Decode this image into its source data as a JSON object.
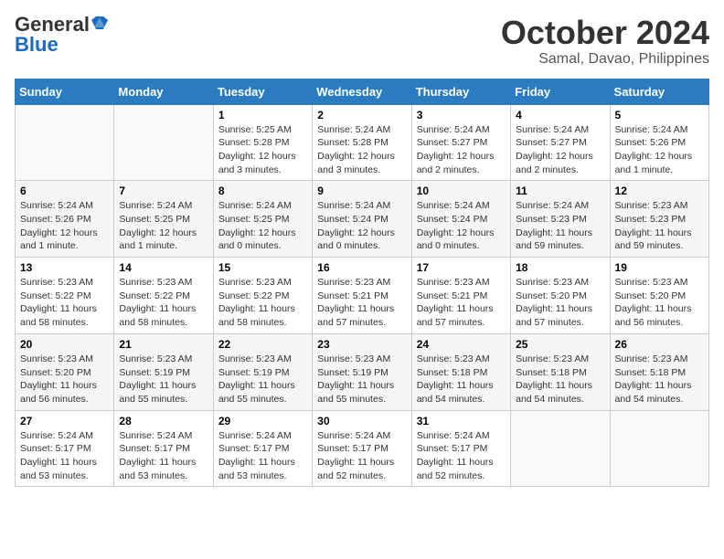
{
  "header": {
    "logo_general": "General",
    "logo_blue": "Blue",
    "month_title": "October 2024",
    "subtitle": "Samal, Davao, Philippines"
  },
  "days_of_week": [
    "Sunday",
    "Monday",
    "Tuesday",
    "Wednesday",
    "Thursday",
    "Friday",
    "Saturday"
  ],
  "weeks": [
    [
      {
        "day": "",
        "detail": ""
      },
      {
        "day": "",
        "detail": ""
      },
      {
        "day": "1",
        "detail": "Sunrise: 5:25 AM\nSunset: 5:28 PM\nDaylight: 12 hours and 3 minutes."
      },
      {
        "day": "2",
        "detail": "Sunrise: 5:24 AM\nSunset: 5:28 PM\nDaylight: 12 hours and 3 minutes."
      },
      {
        "day": "3",
        "detail": "Sunrise: 5:24 AM\nSunset: 5:27 PM\nDaylight: 12 hours and 2 minutes."
      },
      {
        "day": "4",
        "detail": "Sunrise: 5:24 AM\nSunset: 5:27 PM\nDaylight: 12 hours and 2 minutes."
      },
      {
        "day": "5",
        "detail": "Sunrise: 5:24 AM\nSunset: 5:26 PM\nDaylight: 12 hours and 1 minute."
      }
    ],
    [
      {
        "day": "6",
        "detail": "Sunrise: 5:24 AM\nSunset: 5:26 PM\nDaylight: 12 hours and 1 minute."
      },
      {
        "day": "7",
        "detail": "Sunrise: 5:24 AM\nSunset: 5:25 PM\nDaylight: 12 hours and 1 minute."
      },
      {
        "day": "8",
        "detail": "Sunrise: 5:24 AM\nSunset: 5:25 PM\nDaylight: 12 hours and 0 minutes."
      },
      {
        "day": "9",
        "detail": "Sunrise: 5:24 AM\nSunset: 5:24 PM\nDaylight: 12 hours and 0 minutes."
      },
      {
        "day": "10",
        "detail": "Sunrise: 5:24 AM\nSunset: 5:24 PM\nDaylight: 12 hours and 0 minutes."
      },
      {
        "day": "11",
        "detail": "Sunrise: 5:24 AM\nSunset: 5:23 PM\nDaylight: 11 hours and 59 minutes."
      },
      {
        "day": "12",
        "detail": "Sunrise: 5:23 AM\nSunset: 5:23 PM\nDaylight: 11 hours and 59 minutes."
      }
    ],
    [
      {
        "day": "13",
        "detail": "Sunrise: 5:23 AM\nSunset: 5:22 PM\nDaylight: 11 hours and 58 minutes."
      },
      {
        "day": "14",
        "detail": "Sunrise: 5:23 AM\nSunset: 5:22 PM\nDaylight: 11 hours and 58 minutes."
      },
      {
        "day": "15",
        "detail": "Sunrise: 5:23 AM\nSunset: 5:22 PM\nDaylight: 11 hours and 58 minutes."
      },
      {
        "day": "16",
        "detail": "Sunrise: 5:23 AM\nSunset: 5:21 PM\nDaylight: 11 hours and 57 minutes."
      },
      {
        "day": "17",
        "detail": "Sunrise: 5:23 AM\nSunset: 5:21 PM\nDaylight: 11 hours and 57 minutes."
      },
      {
        "day": "18",
        "detail": "Sunrise: 5:23 AM\nSunset: 5:20 PM\nDaylight: 11 hours and 57 minutes."
      },
      {
        "day": "19",
        "detail": "Sunrise: 5:23 AM\nSunset: 5:20 PM\nDaylight: 11 hours and 56 minutes."
      }
    ],
    [
      {
        "day": "20",
        "detail": "Sunrise: 5:23 AM\nSunset: 5:20 PM\nDaylight: 11 hours and 56 minutes."
      },
      {
        "day": "21",
        "detail": "Sunrise: 5:23 AM\nSunset: 5:19 PM\nDaylight: 11 hours and 55 minutes."
      },
      {
        "day": "22",
        "detail": "Sunrise: 5:23 AM\nSunset: 5:19 PM\nDaylight: 11 hours and 55 minutes."
      },
      {
        "day": "23",
        "detail": "Sunrise: 5:23 AM\nSunset: 5:19 PM\nDaylight: 11 hours and 55 minutes."
      },
      {
        "day": "24",
        "detail": "Sunrise: 5:23 AM\nSunset: 5:18 PM\nDaylight: 11 hours and 54 minutes."
      },
      {
        "day": "25",
        "detail": "Sunrise: 5:23 AM\nSunset: 5:18 PM\nDaylight: 11 hours and 54 minutes."
      },
      {
        "day": "26",
        "detail": "Sunrise: 5:23 AM\nSunset: 5:18 PM\nDaylight: 11 hours and 54 minutes."
      }
    ],
    [
      {
        "day": "27",
        "detail": "Sunrise: 5:24 AM\nSunset: 5:17 PM\nDaylight: 11 hours and 53 minutes."
      },
      {
        "day": "28",
        "detail": "Sunrise: 5:24 AM\nSunset: 5:17 PM\nDaylight: 11 hours and 53 minutes."
      },
      {
        "day": "29",
        "detail": "Sunrise: 5:24 AM\nSunset: 5:17 PM\nDaylight: 11 hours and 53 minutes."
      },
      {
        "day": "30",
        "detail": "Sunrise: 5:24 AM\nSunset: 5:17 PM\nDaylight: 11 hours and 52 minutes."
      },
      {
        "day": "31",
        "detail": "Sunrise: 5:24 AM\nSunset: 5:17 PM\nDaylight: 11 hours and 52 minutes."
      },
      {
        "day": "",
        "detail": ""
      },
      {
        "day": "",
        "detail": ""
      }
    ]
  ]
}
